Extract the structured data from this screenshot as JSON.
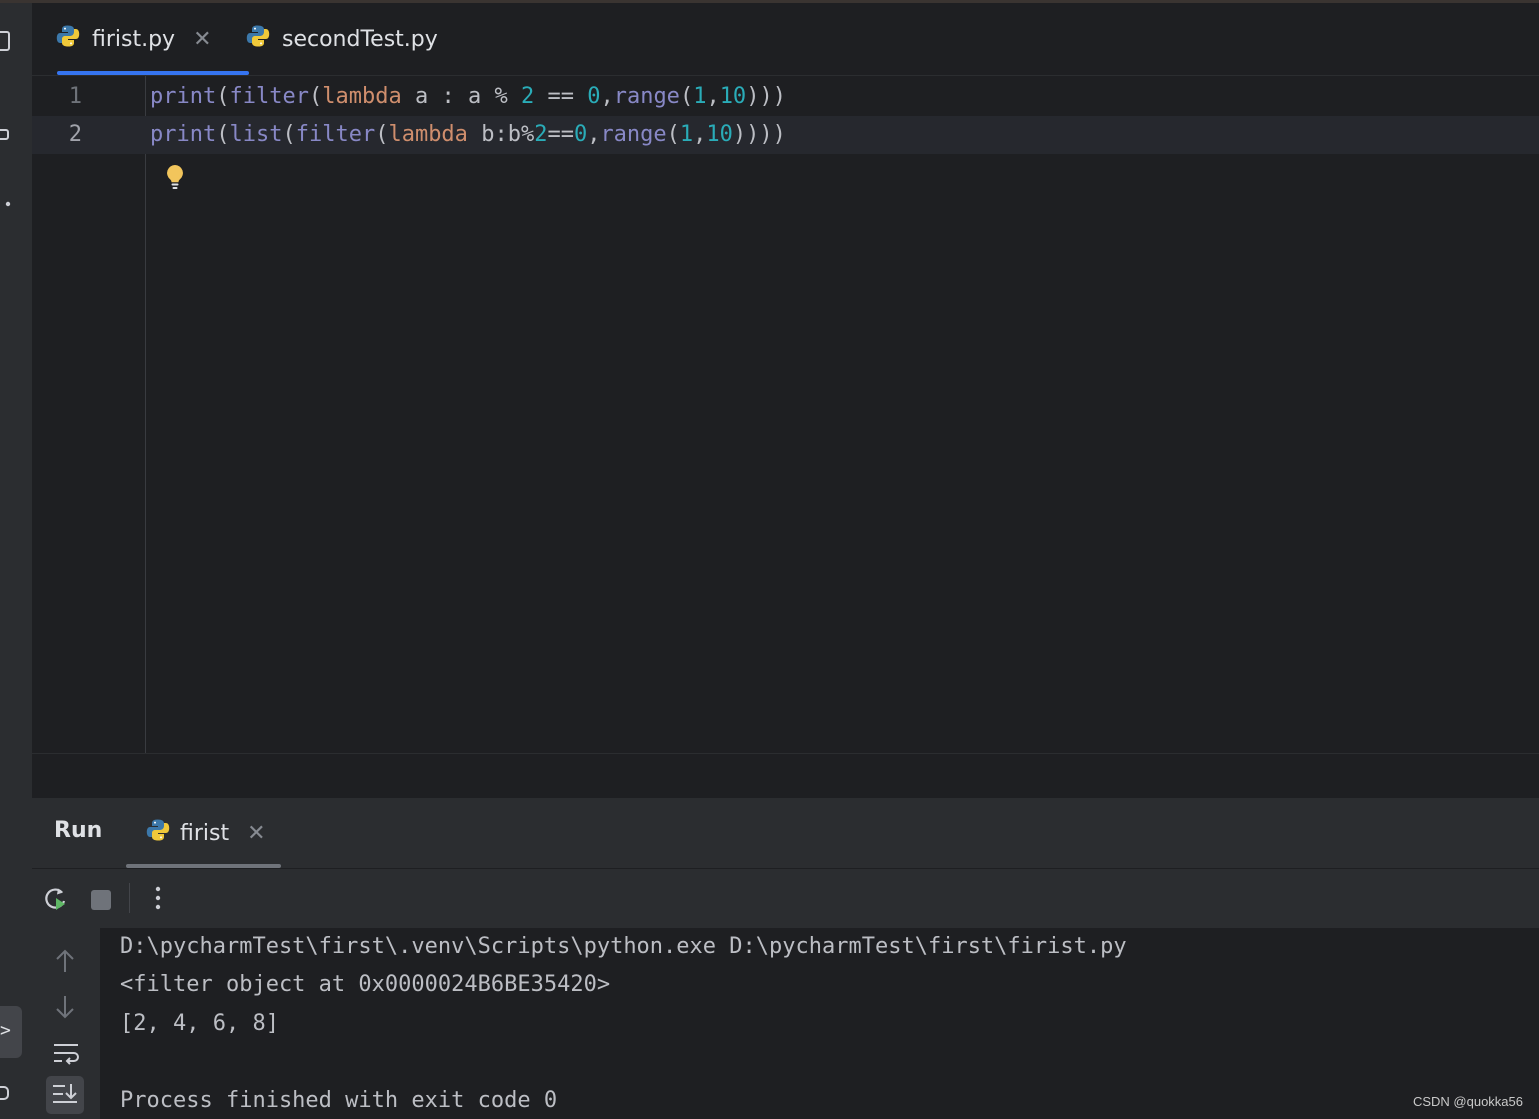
{
  "tabs": [
    {
      "label": "firist.py",
      "active": true,
      "closable": true
    },
    {
      "label": "secondTest.py",
      "active": false,
      "closable": false
    }
  ],
  "editor": {
    "lines": [
      {
        "number": "1",
        "code": "print(filter(lambda a : a % 2 == 0,range(1,10)))"
      },
      {
        "number": "2",
        "code": "print(list(filter(lambda b:b%2==0,range(1,10))))"
      }
    ]
  },
  "run_panel": {
    "title": "Run",
    "tab_label": "firist",
    "output": [
      "D:\\pycharmTest\\first\\.venv\\Scripts\\python.exe D:\\pycharmTest\\first\\firist.py",
      "<filter object at 0x0000024B6BE35420>",
      "[2, 4, 6, 8]",
      "",
      "Process finished with exit code 0"
    ]
  },
  "icons": {
    "file": "python-file-icon",
    "close": "close-icon",
    "rerun": "rerun-icon",
    "stop": "stop-icon",
    "more": "more-vertical-icon",
    "bulb": "intention-bulb-icon",
    "scroll_up": "arrow-up-icon",
    "scroll_down": "arrow-down-icon",
    "soft_wrap": "soft-wrap-icon",
    "scroll_end": "scroll-to-end-icon"
  },
  "colors": {
    "accent": "#3574f0",
    "keyword": "#cf8e6d",
    "builtin": "#8888c6",
    "number": "#2aacb8"
  },
  "watermark": "CSDN @quokka56"
}
